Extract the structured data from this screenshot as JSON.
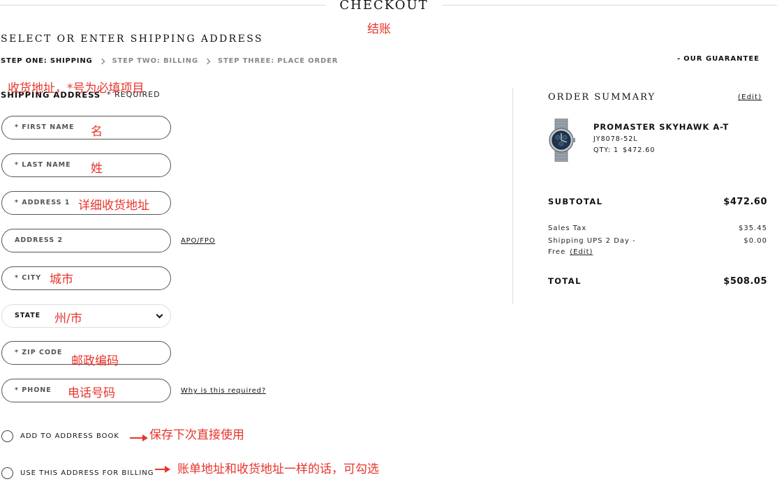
{
  "header": {
    "title": "CHECKOUT",
    "title_annotation": "结账"
  },
  "section_title": "SELECT OR ENTER SHIPPING ADDRESS",
  "steps": [
    {
      "label": "STEP ONE: SHIPPING",
      "active": true
    },
    {
      "label": "STEP TWO: BILLING",
      "active": false
    },
    {
      "label": "STEP THREE: PLACE ORDER",
      "active": false
    }
  ],
  "guarantee": {
    "prefix": "-",
    "label": "OUR GUARANTEE"
  },
  "shipping_address": {
    "heading": "SHIPPING ADDRESS",
    "required_note": "* REQUIRED",
    "heading_annotation": "收货地址，*号为必填项目"
  },
  "fields": {
    "first_name": {
      "label": "* FIRST NAME",
      "annotation": "名"
    },
    "last_name": {
      "label": "* LAST NAME",
      "annotation": "姓"
    },
    "address1": {
      "label": "* ADDRESS 1",
      "annotation": "详细收货地址"
    },
    "address2": {
      "label": "ADDRESS 2",
      "side_link": "APO/FPO"
    },
    "city": {
      "label": "* CITY",
      "annotation": "城市"
    },
    "state": {
      "label": "STATE",
      "annotation": "州/市"
    },
    "zip": {
      "label": "* ZIP CODE",
      "annotation": "邮政编码"
    },
    "phone": {
      "label": "* PHONE",
      "annotation": "电话号码",
      "side_link": "Why is this required?"
    }
  },
  "checkboxes": {
    "address_book": {
      "label": "ADD TO ADDRESS BOOK",
      "annotation": "保存下次直接使用"
    },
    "use_for_billing": {
      "label": "USE THIS ADDRESS FOR BILLING",
      "annotation": "账单地址和收货地址一样的话，可勾选"
    }
  },
  "order_summary": {
    "title": "ORDER SUMMARY",
    "edit_label": "(Edit)",
    "product": {
      "name": "PROMASTER SKYHAWK A-T",
      "sku": "JY8078-52L",
      "qty": "QTY: 1",
      "price": "$472.60"
    },
    "subtotal_label": "SUBTOTAL",
    "subtotal_value": "$472.60",
    "tax_label": "Sales Tax",
    "tax_value": "$35.45",
    "shipping_label_1": "Shipping UPS 2 Day -",
    "shipping_label_2": "Free",
    "shipping_edit": "(Edit)",
    "shipping_value": "$0.00",
    "total_label": "TOTAL",
    "total_value": "$508.05"
  },
  "colors": {
    "annotation": "#e8332a",
    "text": "#111111",
    "muted": "#888888",
    "divider": "#dddddd"
  }
}
